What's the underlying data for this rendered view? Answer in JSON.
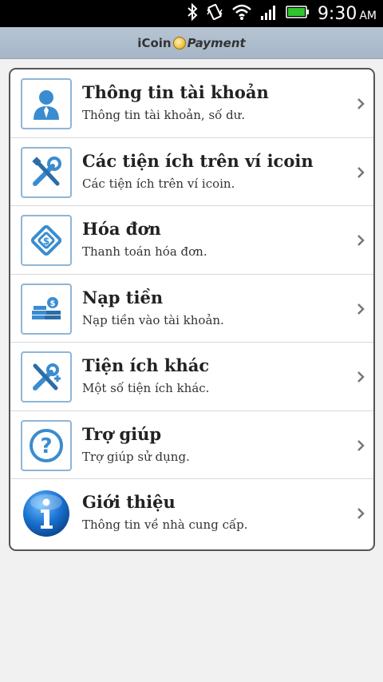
{
  "status_bar": {
    "time": "9:30",
    "ampm": "AM",
    "icons": [
      "bluetooth-icon",
      "vibrate-icon",
      "wifi-icon",
      "signal-icon",
      "battery-icon"
    ]
  },
  "header": {
    "logo_text_1": "iCoin",
    "logo_text_2": "Payment"
  },
  "menu": {
    "items": [
      {
        "title": "Thông tin tài khoản",
        "subtitle": "Thông tin tài khoản, số dư.",
        "icon": "user-icon"
      },
      {
        "title": "Các tiện ích trên ví icoin",
        "subtitle": "Các tiện ích trên ví icoin.",
        "icon": "tools-icon"
      },
      {
        "title": "Hóa đơn",
        "subtitle": "Thanh toán hóa đơn.",
        "icon": "bill-icon"
      },
      {
        "title": "Nạp tiền",
        "subtitle": "Nạp tiền vào tài khoản.",
        "icon": "coins-icon"
      },
      {
        "title": "Tiện ích khác",
        "subtitle": "Một số tiện ích khác.",
        "icon": "tools-plus-icon"
      },
      {
        "title": "Trợ giúp",
        "subtitle": "Trợ giúp sử dụng.",
        "icon": "help-icon"
      },
      {
        "title": "Giới thiệu",
        "subtitle": "Thông tin về nhà cung cấp.",
        "icon": "info-icon"
      }
    ]
  },
  "colors": {
    "accent_blue": "#3a8ccf",
    "icon_border": "#8fb5d6",
    "header_bg": "#b0bfcf"
  }
}
